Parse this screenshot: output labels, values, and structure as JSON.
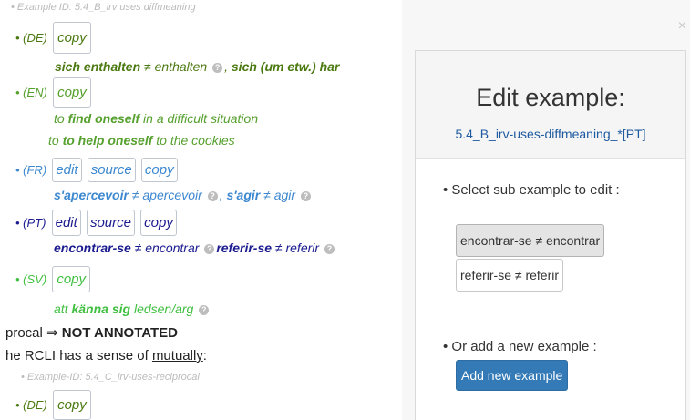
{
  "left": {
    "top_hint": "• Example ID: 5.4_B_irv uses diffmeaning",
    "de": {
      "label": "• (DE)",
      "copy": "copy",
      "text_a": "sich enthalten",
      "text_b": " ≠ enthalten ",
      "text_c": ", ",
      "text_d": "sich (um etw.) har"
    },
    "en": {
      "label": "• (EN)",
      "copy": "copy",
      "line1_pre": "to ",
      "line1_bold": "find oneself",
      "line1_post": " in a difficult situation",
      "line2_pre": "to ",
      "line2_bold": "to help oneself",
      "line2_post": " to the cookies"
    },
    "fr": {
      "label": "• (FR)",
      "edit": "edit",
      "source": "source",
      "copy": "copy",
      "bold1": "s'apercevoir",
      "plain1": " ≠ apercevoir ",
      "sep": ", ",
      "bold2": "s'agir",
      "plain2": " ≠ agir "
    },
    "pt": {
      "label": "• (PT)",
      "edit": "edit",
      "source": "source",
      "copy": "copy",
      "bold1": "encontrar-se",
      "plain1": " ≠ encontrar ",
      "bold2": "referir-se",
      "plain2": " ≠ referir "
    },
    "sv": {
      "label": "• (SV)",
      "copy": "copy",
      "pre": "att ",
      "bold": "känna sig",
      "post": " ledsen/arg "
    },
    "reciprocal": {
      "pre": "procal ⇒ ",
      "bold": "NOT ANNOTATED"
    },
    "sense": {
      "pre": "he RCLI has a sense of ",
      "underline": "mutually",
      "post": ":"
    },
    "example_id": "• Example-ID: 5.4_C_irv-uses-reciprocal",
    "de2": {
      "label": "• (DE)",
      "copy": "copy"
    }
  },
  "modal": {
    "close": "×",
    "title": "Edit example:",
    "subtitle": "5.4_B_irv-uses-diffmeaning_*[PT]",
    "select_label": "• Select sub example to edit :",
    "sub_examples": [
      "encontrar-se ≠ encontrar",
      "referir-se ≠ referir"
    ],
    "add_label": "• Or add a new example :",
    "add_button": "Add new example"
  }
}
